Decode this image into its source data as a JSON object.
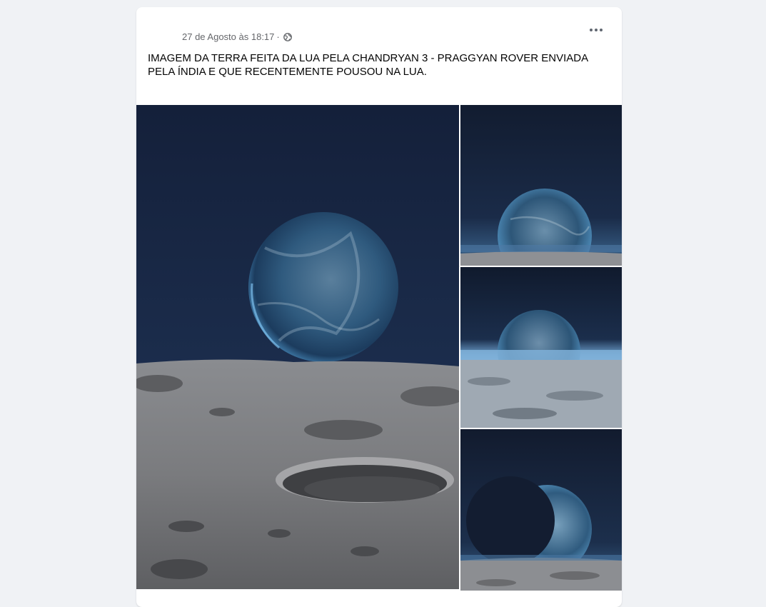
{
  "post": {
    "timestamp": "27 de Agosto às 18:17",
    "separator": "·",
    "privacy_icon": "globe-icon",
    "menu_icon": "more-options-icon",
    "text": "IMAGEM DA TERRA FEITA DA LUA PELA CHANDRYAN 3 - PRAGGYAN ROVER ENVIADA PELA ÍNDIA E QUE RECENTEMENTE POUSOU NA LUA."
  },
  "photos": [
    {
      "name": "earth-over-moon-crater"
    },
    {
      "name": "earth-horizon-small"
    },
    {
      "name": "earth-blue-horizon"
    },
    {
      "name": "earth-crescent-moon"
    }
  ],
  "colors": {
    "page_bg": "#f0f2f5",
    "card_bg": "#ffffff",
    "meta_text": "#65676b",
    "body_text": "#050505"
  }
}
